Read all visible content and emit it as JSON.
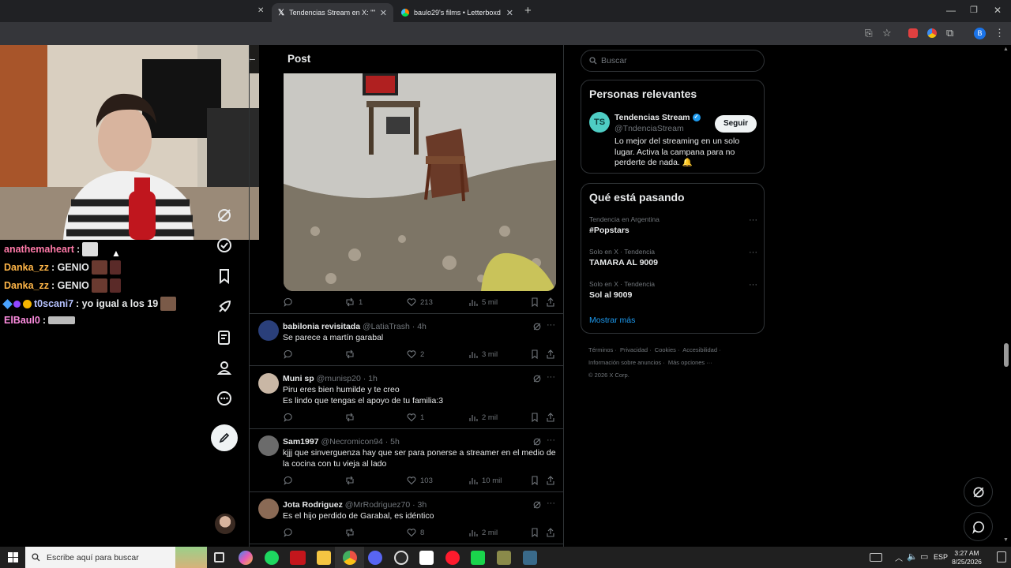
{
  "browser": {
    "tabs": [
      {
        "title": "Tendencias Stream en X: \"\"Piru",
        "favicon": "x-icon",
        "active": true
      },
      {
        "title": "baulo29's films • Letterboxd",
        "favicon": "letterboxd-icon",
        "active": false
      }
    ],
    "new_tab": "+",
    "window_controls": [
      "minimize",
      "restore",
      "close"
    ]
  },
  "stream_chat": [
    {
      "user": "anathemaheart",
      "text": ":",
      "color": "#ff7aa8"
    },
    {
      "user": "Danka_zz",
      "text": ": GENIO",
      "color": "#ffb648"
    },
    {
      "user": "Danka_zz",
      "text": ": GENIO",
      "color": "#ffb648"
    },
    {
      "user": "t0scani7",
      "text": ": yo igual a los 19",
      "color": "#b6c2ff"
    },
    {
      "user": "ElBaul0",
      "text": ":",
      "color": "#ff8ee1"
    }
  ],
  "post_header": {
    "title": "Post",
    "back": "back-arrow-icon"
  },
  "main_post": {
    "replies": "",
    "reposts": "1",
    "likes": "213",
    "views": "5 mil"
  },
  "replies": [
    {
      "name": "babilonia revisitada",
      "handle": "@LatiaTrash",
      "time": "· 4h",
      "text": "Se parece a martín garabal",
      "replies": "",
      "reposts": "",
      "likes": "2",
      "views": "3 mil",
      "avatar_color": "#2a3f7a"
    },
    {
      "name": "Muni sp",
      "handle": "@munisp20",
      "time": "· 1h",
      "text": "Piru eres bien humilde y te creo\nEs lindo que tengas el apoyo de tu familia:3",
      "replies": "",
      "reposts": "",
      "likes": "1",
      "views": "2 mil",
      "avatar_color": "#c9b7a5"
    },
    {
      "name": "Sam1997",
      "handle": "@Necromicon94",
      "time": "· 5h",
      "text": "kjjj que sinverguenza hay que ser para ponerse a streamer en el medio de la cocina con tu vieja al lado",
      "replies": "",
      "reposts": "",
      "likes": "103",
      "views": "10 mil",
      "avatar_color": "#6b6b6b"
    },
    {
      "name": "Jota Rodriguez",
      "handle": "@MrRodriguez70",
      "time": "· 3h",
      "text": "Es el hijo perdido de Garabal, es idéntico",
      "replies": "",
      "reposts": "",
      "likes": "8",
      "views": "2 mil",
      "avatar_color": "#8a6a55"
    }
  ],
  "search": {
    "placeholder": "Buscar"
  },
  "relevant": {
    "title": "Personas relevantes",
    "name": "Tendencias Stream",
    "handle": "@TndenciaStream",
    "follow": "Seguir",
    "bio": "Lo mejor del streaming en un solo lugar. Activa la campana para no perderte de nada. 🔔"
  },
  "trending": {
    "title": "Qué está pasando",
    "items": [
      {
        "context": "Tendencia en Argentina",
        "topic": "#Popstars"
      },
      {
        "context": "Solo en X · Tendencia",
        "topic": "TAMARA AL 9009"
      },
      {
        "context": "Solo en X · Tendencia",
        "topic": "Sol al 9009"
      }
    ],
    "more": "Mostrar más"
  },
  "footer": {
    "links": [
      "Términos",
      "Privacidad",
      "Cookies",
      "Accesibilidad",
      "Información sobre anuncios",
      "Más opciones ···"
    ],
    "copyright": "© 2026 X Corp."
  },
  "taskbar": {
    "search_placeholder": "Escribe aquí para buscar",
    "lang": "ESP",
    "time": "3:27 AM",
    "date": "8/25/2026"
  },
  "colors": {
    "accent": "#1d9bf0",
    "border": "#2f3336",
    "muted": "#71767b"
  }
}
